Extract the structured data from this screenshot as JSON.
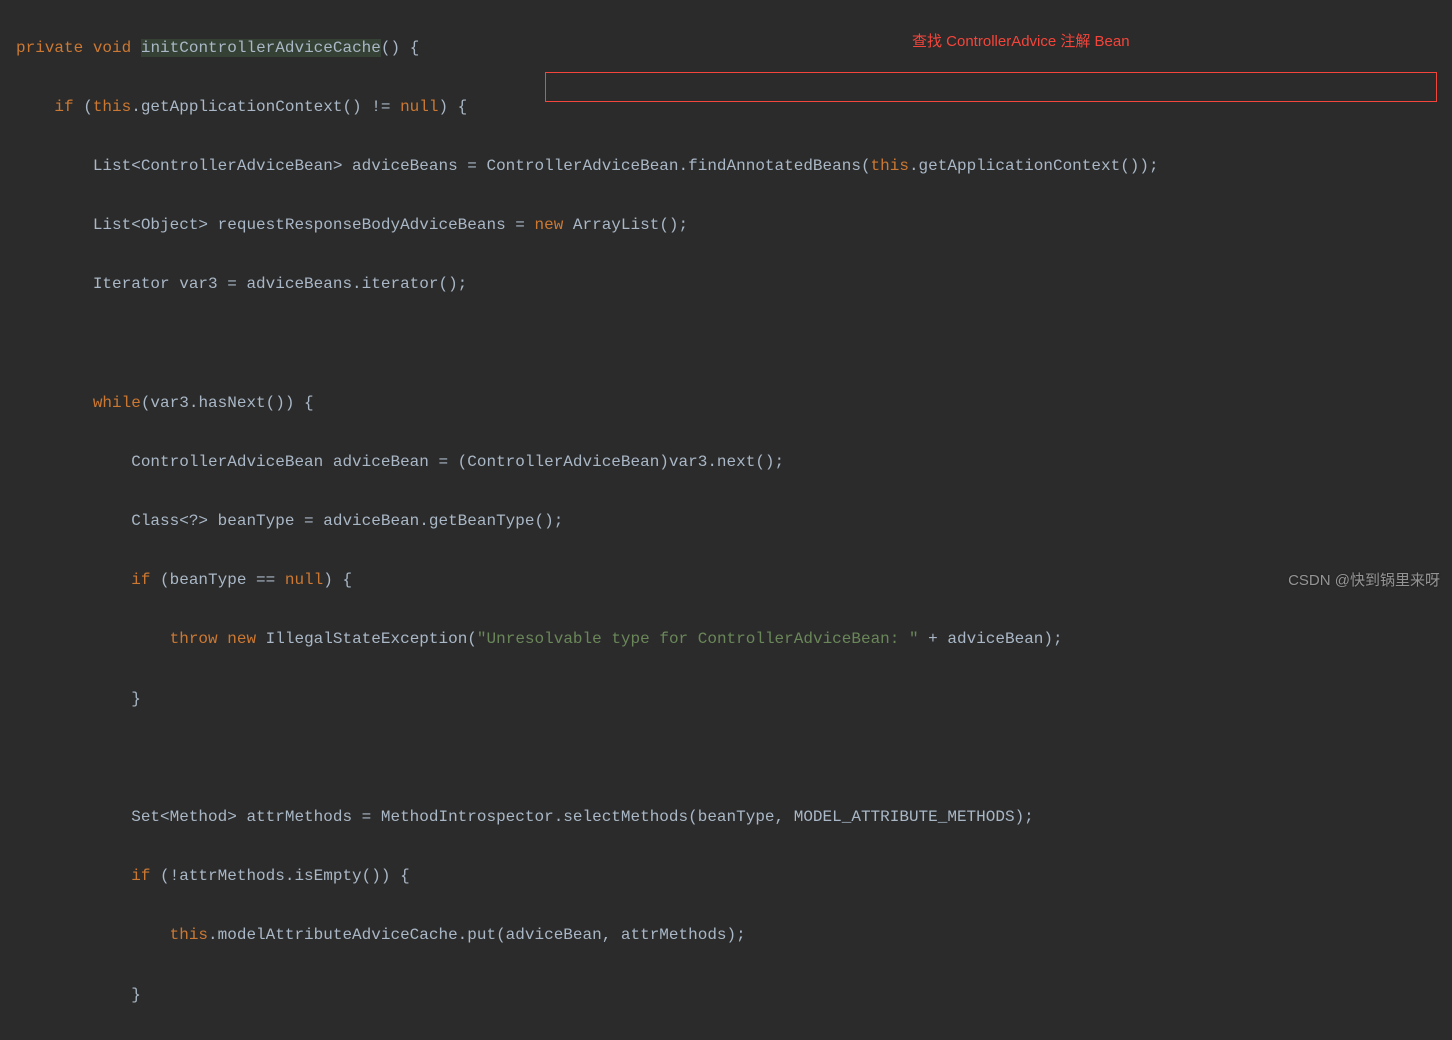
{
  "annotation": "查找 ControllerAdvice 注解 Bean",
  "watermark": "CSDN @快到锅里来呀",
  "code": {
    "l1_kw1": "private",
    "l1_kw2": "void",
    "l1_method": "initControllerAdviceCache",
    "l1_rest": "() {",
    "l2_kw": "if",
    "l2_p1": " (",
    "l2_this": "this",
    "l2_p2": ".getApplicationContext() != ",
    "l2_null": "null",
    "l2_p3": ") {",
    "l3_p1": "List<ControllerAdviceBean> adviceBeans = ControllerAdviceBean.findAnnotatedBeans(",
    "l3_this": "this",
    "l3_p2": ".getApplicationContext());",
    "l4_p1": "List<Object> requestResponseBodyAdviceBeans = ",
    "l4_new": "new",
    "l4_p2": " ArrayList();",
    "l5": "Iterator var3 = adviceBeans.iterator();",
    "l7_kw": "while",
    "l7_rest": "(var3.hasNext()) {",
    "l8": "ControllerAdviceBean adviceBean = (ControllerAdviceBean)var3.next();",
    "l9": "Class<?> beanType = adviceBean.getBeanType();",
    "l10_kw": "if",
    "l10_p1": " (beanType == ",
    "l10_null": "null",
    "l10_p2": ") {",
    "l11_throw": "throw",
    "l11_new": "new",
    "l11_p1": " IllegalStateException(",
    "l11_str": "\"Unresolvable type for ControllerAdviceBean: \"",
    "l11_p2": " + adviceBean);",
    "l12": "}",
    "l14": "Set<Method> attrMethods = MethodIntrospector.selectMethods(beanType, MODEL_ATTRIBUTE_METHODS);",
    "l15_kw": "if",
    "l15_rest": " (!attrMethods.isEmpty()) {",
    "l16_this": "this",
    "l16_rest": ".modelAttributeAdviceCache.put(adviceBean, attrMethods);",
    "l17": "}"
  }
}
